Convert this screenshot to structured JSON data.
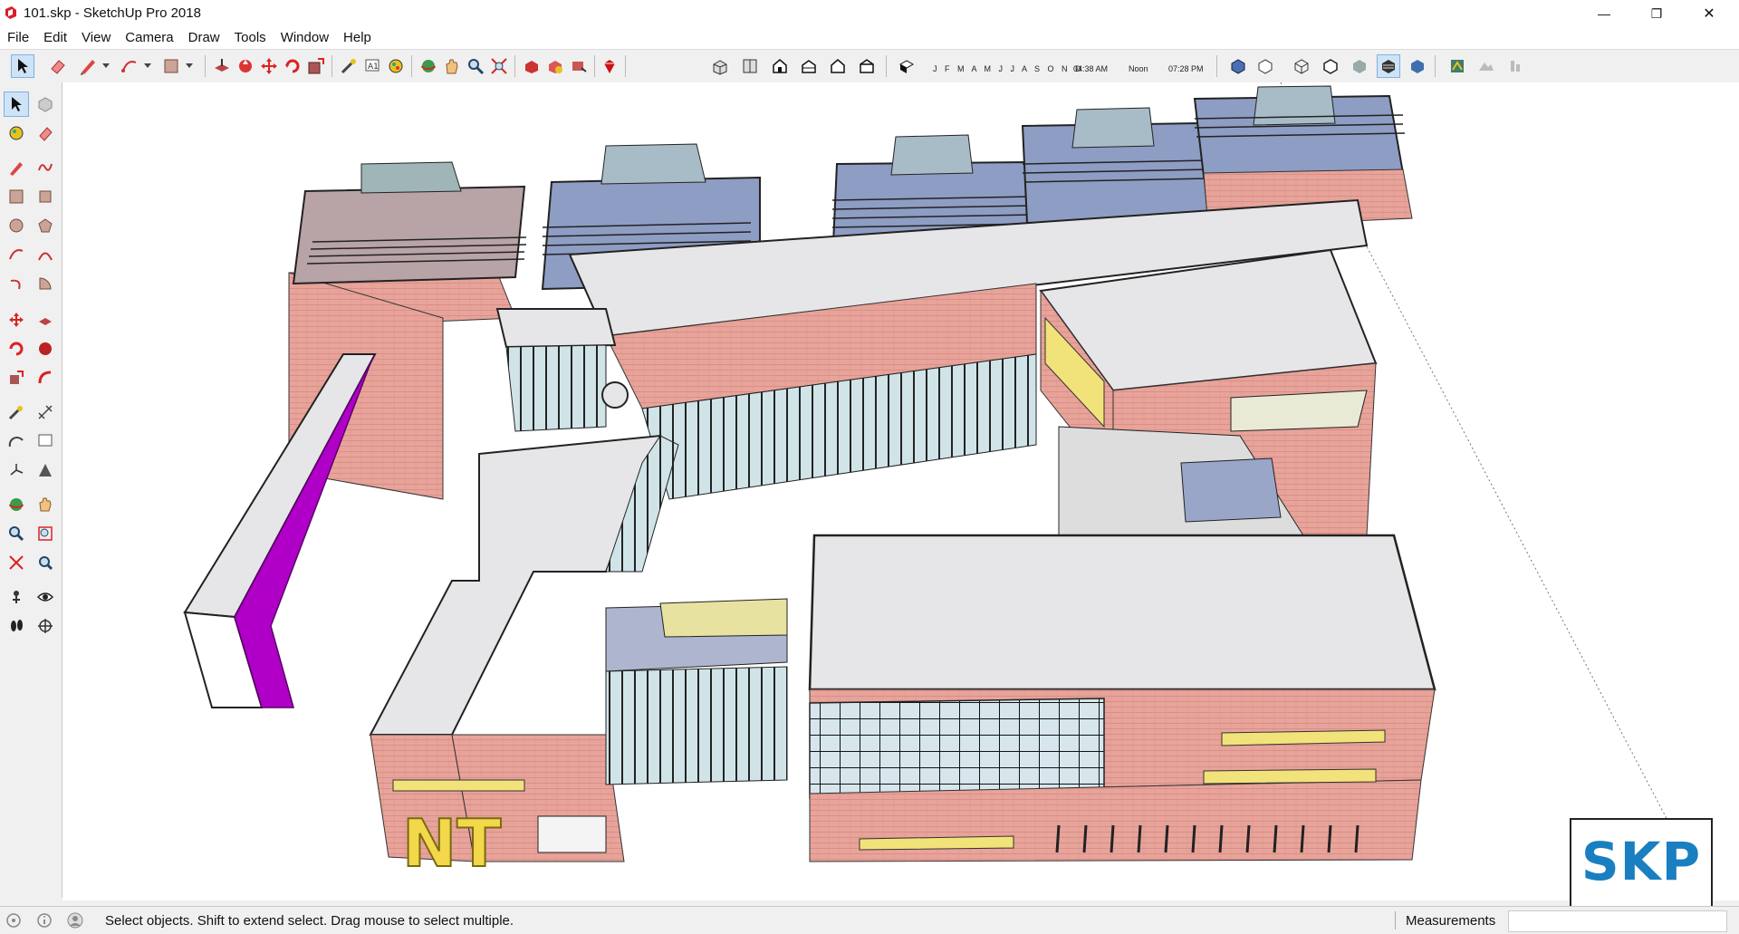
{
  "window": {
    "title": "101.skp - SketchUp Pro 2018",
    "minimize": "—",
    "restore": "❐",
    "close": "✕"
  },
  "menu": [
    "File",
    "Edit",
    "View",
    "Camera",
    "Draw",
    "Tools",
    "Window",
    "Help"
  ],
  "shadows": {
    "months": "J F M A M J J A S O N D",
    "time_start": "04:38 AM",
    "time_mid": "Noon",
    "time_end": "07:28 PM"
  },
  "status": {
    "hint": "Select objects. Shift to extend select. Drag mouse to select multiple.",
    "measurements_label": "Measurements",
    "measurements_value": ""
  },
  "model": {
    "sign_text": "NT"
  },
  "watermark": "SKP",
  "colors": {
    "brick": "#e8a39a",
    "roof": "#e6e6e8",
    "glass": "#c9dde6",
    "skylight": "#9aa6c8",
    "highlight": "#b000c8",
    "accent_yellow": "#f2e27a"
  }
}
